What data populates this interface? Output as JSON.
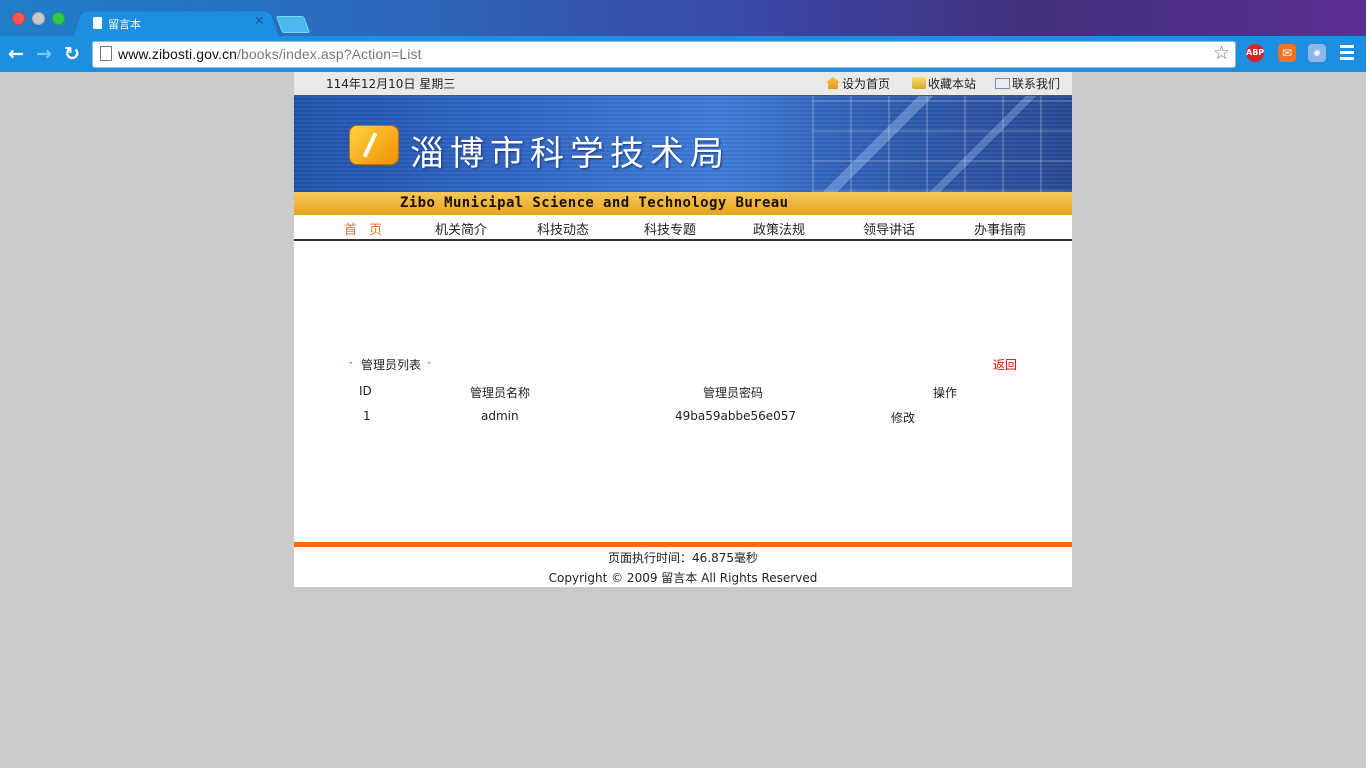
{
  "browser": {
    "tab_title": "留言本",
    "url_host": "www.zibosti.gov.cn",
    "url_path": "/books/index.asp?Action=List"
  },
  "page": {
    "date": "114年12月10日 星期三",
    "top_links": [
      "设为首页",
      "收藏本站",
      "联系我们"
    ],
    "banner_title": "淄博市科学技术局",
    "banner_subtitle": "Zibo Municipal Science and Technology Bureau",
    "nav": [
      "首 页",
      "机关简介",
      "科技动态",
      "科技专题",
      "政策法规",
      "领导讲话",
      "办事指南"
    ],
    "section_title": "管理员列表",
    "section_bullet": "·",
    "back": "返回",
    "table": {
      "headers": [
        "ID",
        "管理员名称",
        "管理员密码",
        "操作"
      ],
      "rows": [
        [
          "1",
          "admin",
          "49ba59abbe56e057",
          "修改"
        ]
      ]
    },
    "footer": {
      "exec_time": "页面执行时间：46.875毫秒",
      "copyright": "Copyright © 2009 留言本 All Rights Reserved"
    }
  },
  "colors": {
    "nav_active": "#ff6a13",
    "back_link": "#e60000",
    "footer_bar": "#f56a05"
  }
}
